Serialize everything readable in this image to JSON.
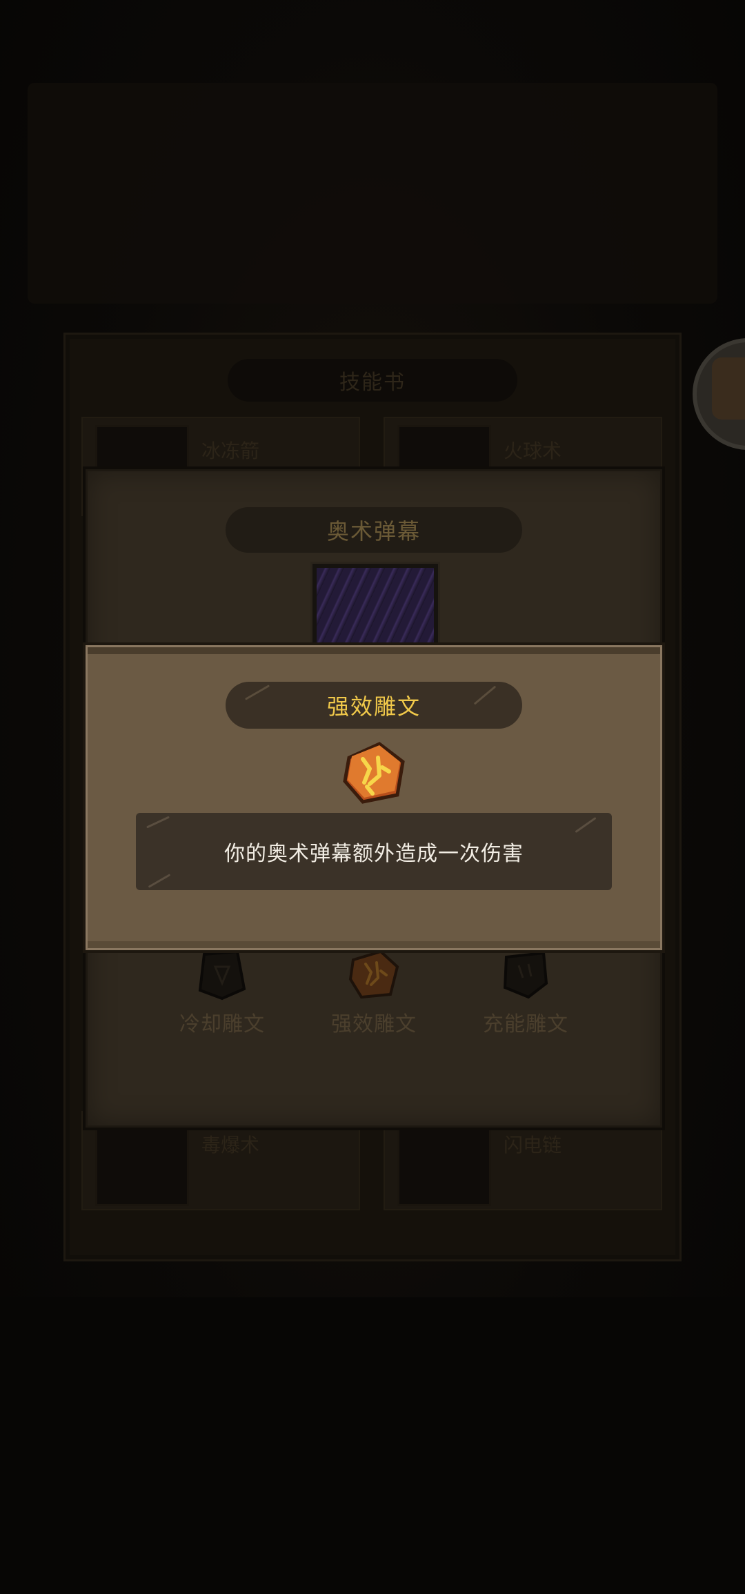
{
  "background": {
    "skills_title": "技能书",
    "skill_cards": [
      {
        "name": "冰冻箭"
      },
      {
        "name": "火球术"
      },
      {
        "name": "毒爆术"
      },
      {
        "name": "闪电链"
      }
    ]
  },
  "skill_dialog": {
    "title": "奥术弹幕",
    "runes": [
      {
        "label": "冷却雕文",
        "icon": "cooldown-rune-icon"
      },
      {
        "label": "强效雕文",
        "icon": "power-rune-icon"
      },
      {
        "label": "充能雕文",
        "icon": "charge-rune-icon"
      }
    ]
  },
  "rune_dialog": {
    "title": "强效雕文",
    "icon": "power-rune-icon",
    "description": "你的奥术弹幕额外造成一次伤害"
  },
  "colors": {
    "title_gold": "#f1c94a",
    "panel_tan": "#6b5a44",
    "pill_dark": "#3a3025",
    "rune_orange": "#e07a2e"
  }
}
